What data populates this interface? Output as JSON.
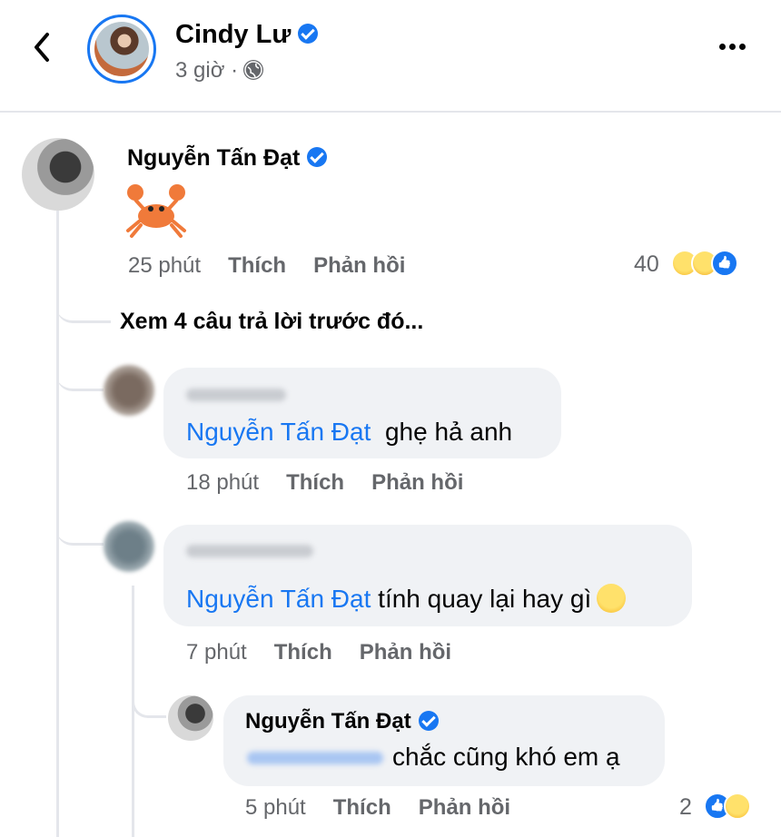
{
  "header": {
    "page_name": "Cindy Lư",
    "post_time": "3 giờ ·"
  },
  "comments": {
    "top": {
      "author": "Nguyễn Tấn Đạt",
      "content_emoji": "crab",
      "time": "25 phút",
      "like": "Thích",
      "reply": "Phản hồi",
      "reaction_count": "40"
    },
    "view_previous": "Xem 4 câu trả lời trước đó...",
    "reply1": {
      "mention": "Nguyễn Tấn Đạt",
      "text": "ghẹ hả anh",
      "time": "18 phút",
      "like": "Thích",
      "reply": "Phản hồi"
    },
    "reply2": {
      "mention": "Nguyễn Tấn Đạt",
      "text": "tính quay lại hay gì",
      "time": "7 phút",
      "like": "Thích",
      "reply": "Phản hồi"
    },
    "reply3": {
      "author": "Nguyễn Tấn Đạt",
      "text": "chắc cũng khó em ạ",
      "time": "5 phút",
      "like": "Thích",
      "reply": "Phản hồi",
      "reaction_count": "2"
    }
  },
  "colors": {
    "accent": "#1877f2",
    "secondary_text": "#65676b",
    "bubble": "#f0f2f5"
  }
}
